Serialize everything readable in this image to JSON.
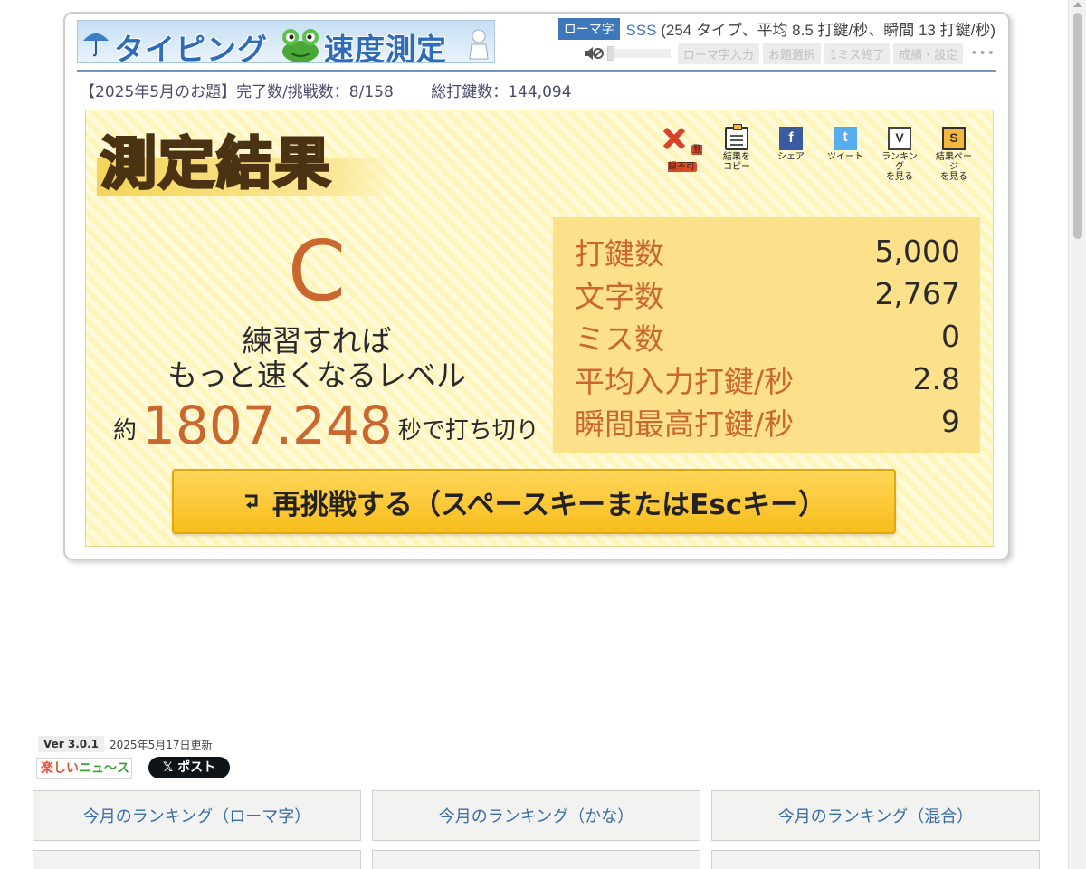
{
  "header": {
    "logo_text_a": "タイピング",
    "logo_text_b": "速度測定",
    "mode_badge": "ローマ字",
    "rank_grade": "SSS",
    "rank_detail": "(254 タイプ、平均 8.5 打鍵/秒、瞬間 13 打鍵/秒)",
    "toolbar": [
      "ローマ字入力",
      "お題選択",
      "1ミス終了",
      "成績・設定"
    ],
    "more": "•••"
  },
  "stats": {
    "topic_progress": "【2025年5月のお題】完了数/挑戦数：8/158",
    "total_keystrokes": "総打鍵数：144,094"
  },
  "result": {
    "title": "測定結果",
    "actions": [
      {
        "icon": "cross-icon",
        "label": "登録不可"
      },
      {
        "icon": "clipboard-icon",
        "label": "結果を\nコピー"
      },
      {
        "icon": "facebook-icon",
        "label": "シェア"
      },
      {
        "icon": "twitter-icon",
        "label": "ツイート"
      },
      {
        "icon": "v-icon",
        "label": "ランキング\nを見る"
      },
      {
        "icon": "s-icon",
        "label": "結果ページ\nを見る"
      }
    ],
    "grade": "C",
    "comment_line1": "練習すれば",
    "comment_line2": "もっと速くなるレベル",
    "estimate_pre": "約",
    "estimate_value": "1807.248",
    "estimate_post": "秒で打ち切り",
    "metrics": [
      {
        "label": "打鍵数",
        "value": "5,000"
      },
      {
        "label": "文字数",
        "value": "2,767"
      },
      {
        "label": "ミス数",
        "value": "0"
      },
      {
        "label": "平均入力打鍵/秒",
        "value": "2.8"
      },
      {
        "label": "瞬間最高打鍵/秒",
        "value": "9"
      }
    ],
    "retry_label": "再挑戦する（スペースキーまたはEscキー）"
  },
  "footer": {
    "version": "Ver 3.0.1",
    "updated": "2025年5月17日更新",
    "news_logo_a": "楽しい",
    "news_logo_b": "ニュ〜ス",
    "x_post": "𝕏 ポスト",
    "rankings": [
      "今月のランキング（ローマ字）",
      "今月のランキング（かな）",
      "今月のランキング（混合）"
    ]
  },
  "colors": {
    "accent_blue": "#3f78ba",
    "grade_orange": "#c9672f",
    "result_bg": "#fff8c6",
    "metrics_bg": "#fde08a",
    "retry_button": "#f7bd1c"
  }
}
